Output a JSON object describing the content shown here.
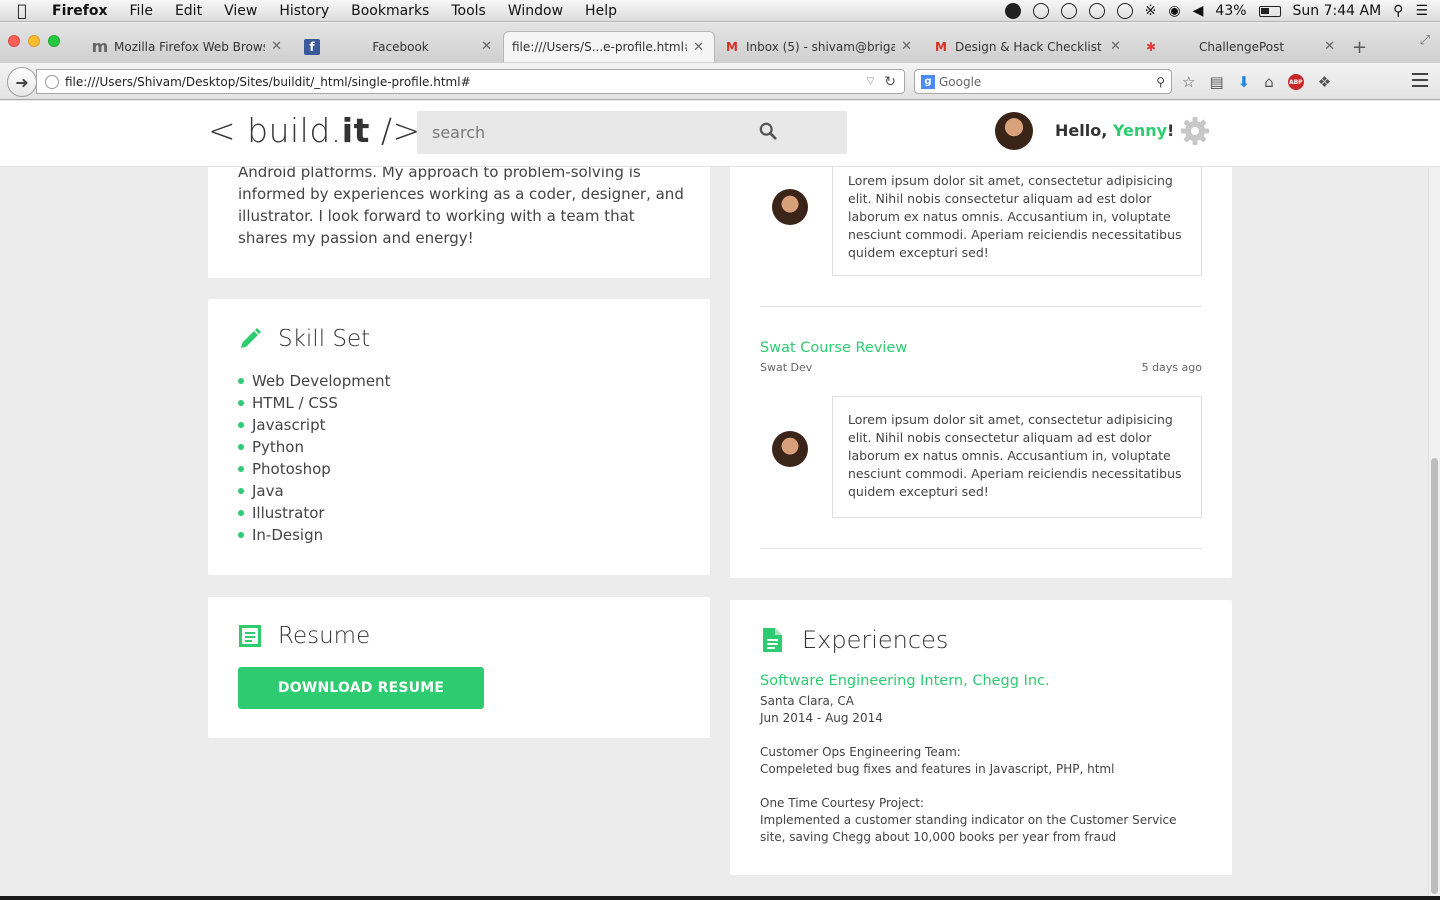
{
  "os_menubar": {
    "app": "Firefox",
    "items": [
      "File",
      "Edit",
      "View",
      "History",
      "Bookmarks",
      "Tools",
      "Window",
      "Help"
    ],
    "battery": "43%",
    "clock": "Sun 7:44 AM"
  },
  "browser": {
    "tabs": [
      {
        "label": "Mozilla Firefox Web Brows...",
        "icon": "m"
      },
      {
        "label": "Facebook",
        "icon": "f"
      },
      {
        "label": "file:///Users/S...e-profile.html#",
        "icon": ""
      },
      {
        "label": "Inbox (5) - shivam@briga...",
        "icon": "M"
      },
      {
        "label": "Design & Hack Checklist (...",
        "icon": "M"
      },
      {
        "label": "ChallengePost",
        "icon": "✱"
      }
    ],
    "url": "file:///Users/Shivam/Desktop/Sites/buildit/_html/single-profile.html#",
    "search_placeholder": "Google"
  },
  "site": {
    "logo_pre": "< build.",
    "logo_bold": "it",
    "logo_post": " />",
    "search_placeholder": "search",
    "greeting": "Hello, ",
    "user_name": "Yenny",
    "greeting_end": "!"
  },
  "about": {
    "text": "Android platforms. My approach to problem-solving is informed by experiences working as a coder, designer, and illustrator. I look forward to working with a team that shares my passion and energy!"
  },
  "skills": {
    "title": "Skill Set",
    "items": [
      "Web Development",
      "HTML / CSS",
      "Javascript",
      "Python",
      "Photoshop",
      "Java",
      "Illustrator",
      "In-Design"
    ]
  },
  "resume": {
    "title": "Resume",
    "button": "DOWNLOAD RESUME"
  },
  "reviews": [
    {
      "body": "Lorem ipsum dolor sit amet, consectetur adipisicing elit. Nihil nobis consectetur aliquam ad est dolor laborum ex natus omnis. Accusantium in, voluptate nesciunt commodi. Aperiam reiciendis necessitatibus quidem excepturi sed!"
    },
    {
      "title": "Swat Course Review",
      "author": "Swat Dev",
      "time": "5 days ago",
      "body": "Lorem ipsum dolor sit amet, consectetur adipisicing elit. Nihil nobis consectetur aliquam ad est dolor laborum ex natus omnis. Accusantium in, voluptate nesciunt commodi. Aperiam reiciendis necessitatibus quidem excepturi sed!"
    }
  ],
  "experiences": {
    "title": "Experiences",
    "job": "Software Engineering Intern, Chegg Inc.",
    "location": "Santa Clara, CA",
    "dates": "Jun 2014 - Aug 2014",
    "team_label": "Customer Ops Engineering Team:",
    "team_desc": "Compeleted bug fixes and features in Javascript, PHP, html",
    "project_label": "One Time Courtesy Project:",
    "project_desc": "Implemented a customer standing indicator on the Customer Service site, saving Chegg about 10,000 books per year from fraud"
  },
  "colors": {
    "accent": "#2ecc71",
    "background": "#ececec"
  }
}
